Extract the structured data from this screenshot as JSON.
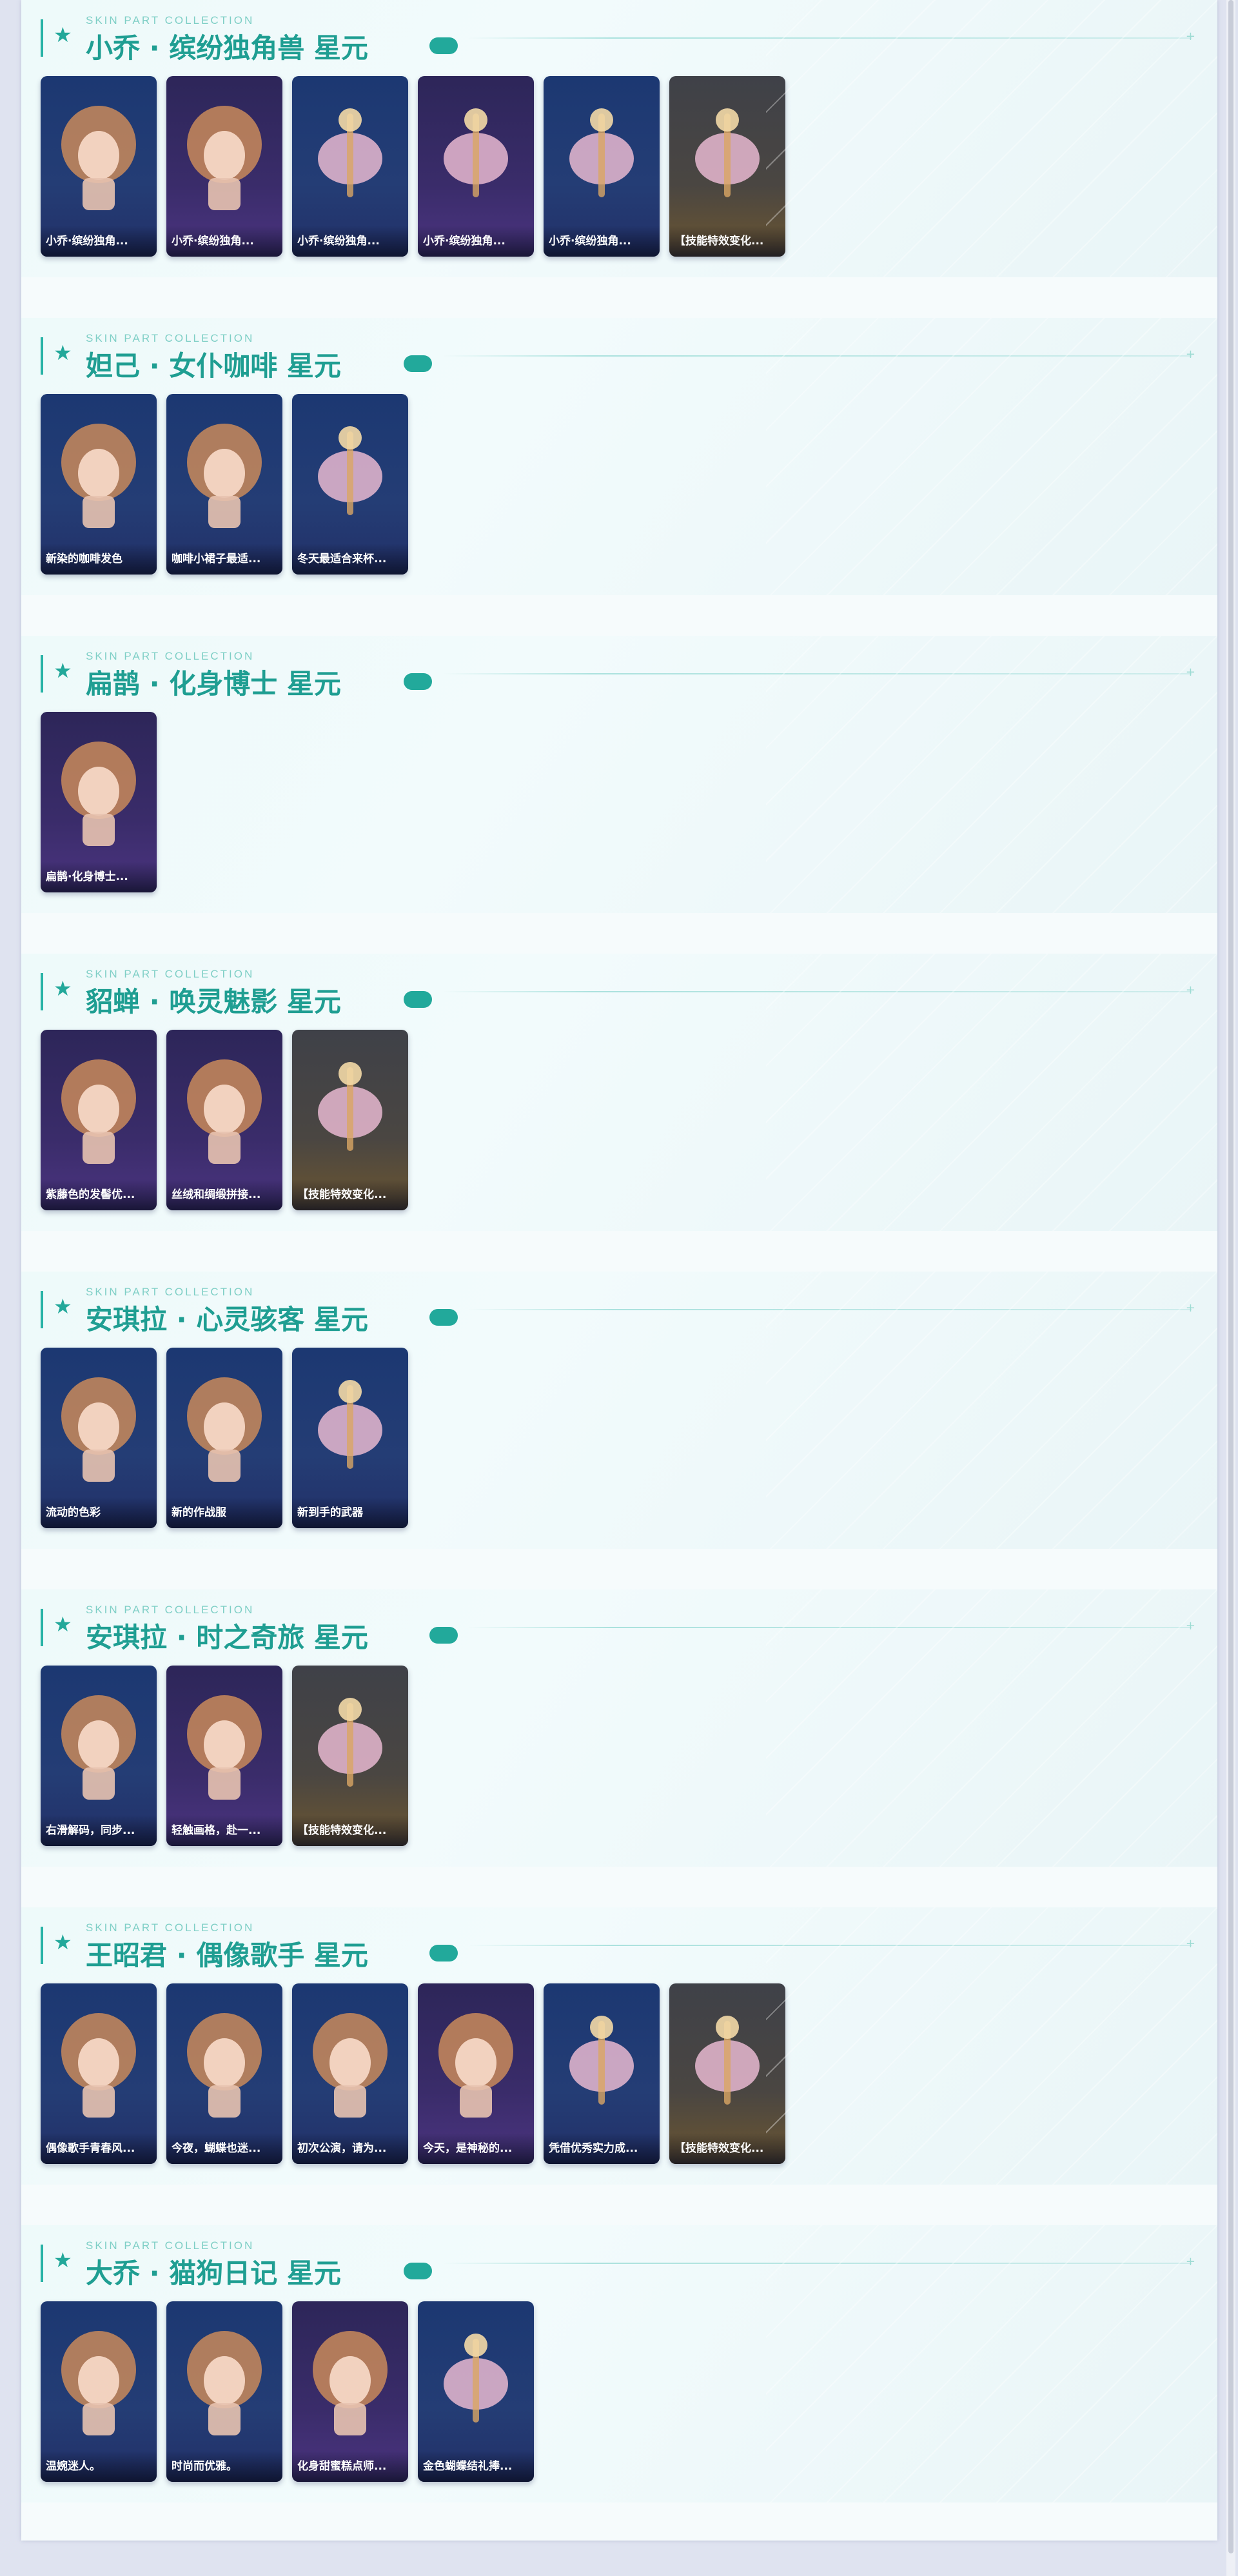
{
  "subtitle": "SKIN PART COLLECTION",
  "sections": [
    {
      "title": "小乔 · 缤纷独角兽 星元",
      "cards": [
        {
          "caption": "小乔·缤纷独角...",
          "tone": "blue",
          "icon": "pastel-hair-icon"
        },
        {
          "caption": "小乔·缤纷独角...",
          "tone": "purple",
          "icon": "heart-sunglasses-hair-icon"
        },
        {
          "caption": "小乔·缤纷独角...",
          "tone": "blue",
          "icon": "unicorn-float-icon"
        },
        {
          "caption": "小乔·缤纷独角...",
          "tone": "purple",
          "icon": "unicorn-float-icon"
        },
        {
          "caption": "小乔·缤纷独角...",
          "tone": "blue",
          "icon": "rainbow-cloud-icon"
        },
        {
          "caption": "【技能特效变化...",
          "tone": "gold",
          "icon": "pink-swan-icon"
        }
      ]
    },
    {
      "title": "妲己 · 女仆咖啡 星元",
      "cards": [
        {
          "caption": "新染的咖啡发色",
          "tone": "blue",
          "icon": "fox-ear-hair-icon"
        },
        {
          "caption": "咖啡小裙子最适...",
          "tone": "blue",
          "icon": "maid-dress-icon"
        },
        {
          "caption": "冬天最适合来杯...",
          "tone": "blue",
          "icon": "fox-tail-icon"
        }
      ]
    },
    {
      "title": "扁鹊 · 化身博士 星元",
      "cards": [
        {
          "caption": "扁鹊·化身博士...",
          "tone": "purple",
          "icon": "glasses-head-icon"
        }
      ]
    },
    {
      "title": "貂蝉 · 唤灵魅影 星元",
      "cards": [
        {
          "caption": "紫藤色的发髻优...",
          "tone": "purple",
          "icon": "pink-hair-icon"
        },
        {
          "caption": "丝绒和绸缎拼接...",
          "tone": "purple",
          "icon": "blue-gown-icon"
        },
        {
          "caption": "【技能特效变化...",
          "tone": "gold",
          "icon": "dark-blades-icon"
        }
      ]
    },
    {
      "title": "安琪拉 · 心灵骇客 星元",
      "cards": [
        {
          "caption": "流动的色彩",
          "tone": "blue",
          "icon": "bunny-ear-hair-icon"
        },
        {
          "caption": "新的作战服",
          "tone": "blue",
          "icon": "hacker-suit-icon"
        },
        {
          "caption": "新到手的武器",
          "tone": "blue",
          "icon": "tablet-weapon-icon"
        }
      ]
    },
    {
      "title": "安琪拉 · 时之奇旅 星元",
      "cards": [
        {
          "caption": "右滑解码，同步...",
          "tone": "blue",
          "icon": "blue-twin-hair-icon"
        },
        {
          "caption": "轻触画格，赴一...",
          "tone": "purple",
          "icon": "plaid-outfit-icon"
        },
        {
          "caption": "【技能特效变化...",
          "tone": "gold",
          "icon": "dark-gun-icon"
        }
      ]
    },
    {
      "title": "王昭君 · 偶像歌手 星元",
      "cards": [
        {
          "caption": "偶像歌手青春风...",
          "tone": "blue",
          "icon": "brown-hair-icon"
        },
        {
          "caption": "今夜，蝴蝶也迷...",
          "tone": "blue",
          "icon": "white-hair-hat-icon"
        },
        {
          "caption": "初次公演，请为...",
          "tone": "blue",
          "icon": "red-dress-icon"
        },
        {
          "caption": "今天，是神秘的...",
          "tone": "purple",
          "icon": "black-dress-icon"
        },
        {
          "caption": "凭借优秀实力成...",
          "tone": "blue",
          "icon": "heart-staff-icon"
        },
        {
          "caption": "【技能特效变化...",
          "tone": "gold",
          "icon": "moon-staff-icon"
        }
      ]
    },
    {
      "title": "大乔 · 猫狗日记 星元",
      "cards": [
        {
          "caption": "温婉迷人。",
          "tone": "blue",
          "icon": "cream-hair-icon"
        },
        {
          "caption": "时尚而优雅。",
          "tone": "blue",
          "icon": "cat-outfit-icon"
        },
        {
          "caption": "化身甜蜜糕点师...",
          "tone": "purple",
          "icon": "yellow-dress-icon"
        },
        {
          "caption": "金色蝴蝶结礼捧...",
          "tone": "blue",
          "icon": "pet-staff-icon"
        }
      ]
    }
  ]
}
